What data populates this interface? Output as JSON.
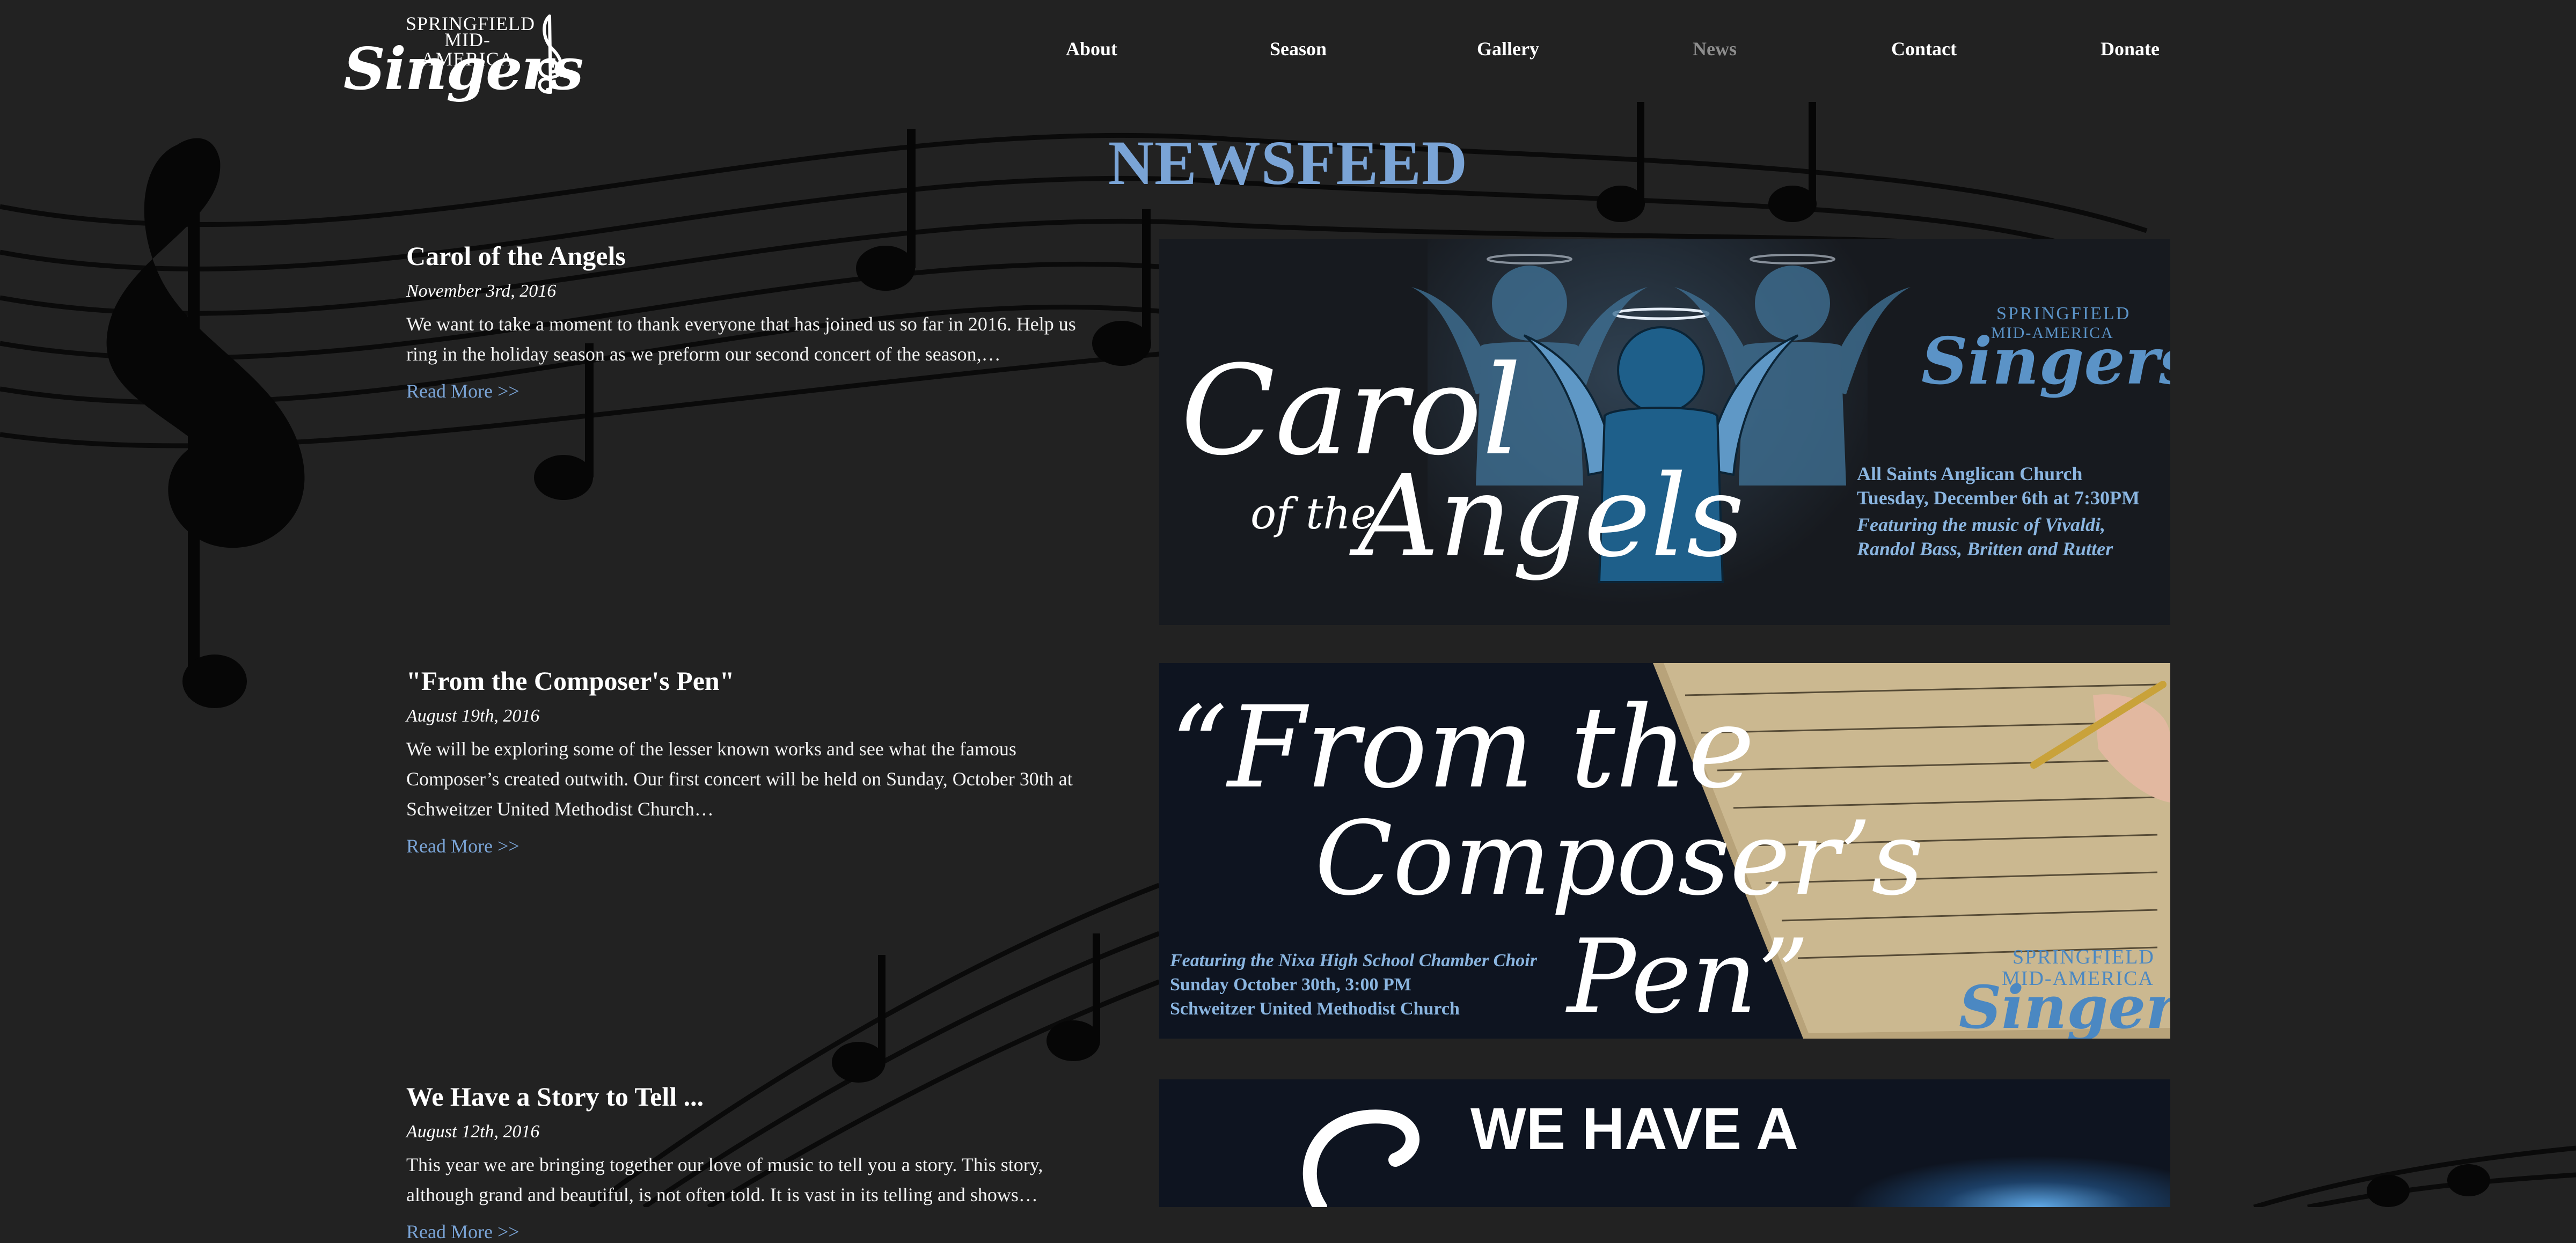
{
  "brand": {
    "line1": "SPRINGFIELD",
    "line2": "MID-AMERICA",
    "line3": "Singers"
  },
  "nav": {
    "items": [
      {
        "label": "About"
      },
      {
        "label": "Season"
      },
      {
        "label": "Gallery"
      },
      {
        "label": "News",
        "active": true
      },
      {
        "label": "Contact"
      },
      {
        "label": "Donate"
      }
    ]
  },
  "page": {
    "title": "NEWSFEED"
  },
  "posts": [
    {
      "title": "Carol of the Angels",
      "date": "November 3rd, 2016",
      "excerpt": "We want to take a moment to thank everyone that has joined us so far in 2016. Help us ring in the holiday season as we preform our second concert of the season,…",
      "read_more": "Read More >>",
      "banner": {
        "script_line1": "Carol",
        "script_line2": "of the",
        "script_line3": "Angels",
        "brand_line1": "SPRINGFIELD",
        "brand_line2": "MID-AMERICA",
        "brand_line3": "Singers",
        "info_line1": "All Saints Anglican Church",
        "info_line2": "Tuesday, December 6th at 7:30PM",
        "info_line3": "Featuring the music of Vivaldi,",
        "info_line4": "Randol Bass, Britten and Rutter"
      }
    },
    {
      "title": "\"From the Composer's Pen\"",
      "date": "August 19th, 2016",
      "excerpt": "We will be exploring some of the lesser known works and see what the famous Composer’s created outwith. Our first concert will be held on Sunday, October 30th at Schweitzer United Methodist Church…",
      "read_more": "Read More >>",
      "banner": {
        "script_line1": "“From the",
        "script_line2": "Composer’s",
        "script_line3": "Pen”",
        "info_line1": "Featuring the Nixa High School Chamber Choir",
        "info_line2": "Sunday October 30th, 3:00 PM",
        "info_line3": "Schweitzer United Methodist Church",
        "brand_line1": "SPRINGFIELD",
        "brand_line2": "MID-AMERICA",
        "brand_line3": "Singers"
      }
    },
    {
      "title": "We Have a Story to Tell ...",
      "date": "August 12th, 2016",
      "excerpt": "This year we are bringing together our love of music to tell you a story. This story, although grand and beautiful, is not often told. It is vast in its telling and shows…",
      "read_more": "Read More >>",
      "banner": {
        "headline": "WE HAVE A"
      }
    }
  ],
  "colors": {
    "background": "#222222",
    "accent": "#7aa4d6",
    "nav_active": "#8d8d8d",
    "banner_dark": "#0e1420"
  }
}
